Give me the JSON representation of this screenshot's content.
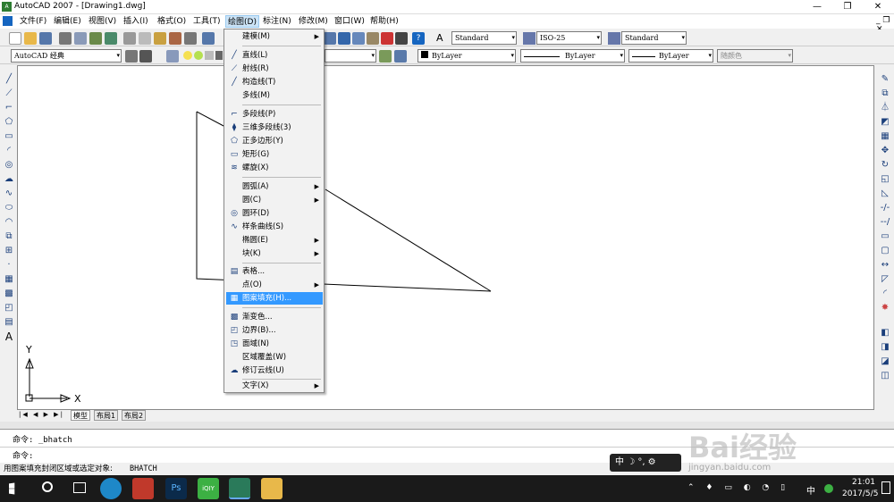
{
  "titlebar": {
    "title": "AutoCAD 2007 - [Drawing1.dwg]",
    "minimize": "—",
    "restore": "❐",
    "close": "✕"
  },
  "menubar": {
    "items": [
      "文件(F)",
      "编辑(E)",
      "视图(V)",
      "插入(I)",
      "格式(O)",
      "工具(T)",
      "绘图(D)",
      "标注(N)",
      "修改(M)",
      "窗口(W)",
      "帮助(H)"
    ],
    "active": "绘图(D)"
  },
  "toolbar": {
    "text_style": "Standard",
    "dim_style": "ISO-25",
    "table_style": "Standard",
    "workspace": "AutoCAD 经典",
    "color": "ByLayer",
    "linetype": "ByLayer",
    "lineweight": "ByLayer",
    "plotstyle": "随颜色"
  },
  "dropdown": {
    "items": [
      {
        "label": "建模(M)",
        "icon": "",
        "submenu": true
      },
      {
        "label": "直线(L)",
        "icon": "line-icon"
      },
      {
        "label": "射线(R)",
        "icon": "ray-icon"
      },
      {
        "label": "构造线(T)",
        "icon": "xline-icon"
      },
      {
        "label": "多线(M)",
        "icon": ""
      },
      {
        "label": "多段线(P)",
        "icon": "polyline-icon"
      },
      {
        "label": "三维多段线(3)",
        "icon": "3dpoly-icon"
      },
      {
        "label": "正多边形(Y)",
        "icon": "polygon-icon"
      },
      {
        "label": "矩形(G)",
        "icon": "rectangle-icon"
      },
      {
        "label": "螺旋(X)",
        "icon": "helix-icon"
      },
      {
        "label": "圆弧(A)",
        "icon": "",
        "submenu": true
      },
      {
        "label": "圆(C)",
        "icon": "",
        "submenu": true
      },
      {
        "label": "圆环(D)",
        "icon": "donut-icon"
      },
      {
        "label": "样条曲线(S)",
        "icon": "spline-icon"
      },
      {
        "label": "椭圆(E)",
        "icon": "",
        "submenu": true
      },
      {
        "label": "块(K)",
        "icon": "",
        "submenu": true
      },
      {
        "label": "表格...",
        "icon": "table-icon"
      },
      {
        "label": "点(O)",
        "icon": "",
        "submenu": true
      },
      {
        "label": "图案填充(H)...",
        "icon": "hatch-icon",
        "highlighted": true
      },
      {
        "label": "渐变色...",
        "icon": "gradient-icon"
      },
      {
        "label": "边界(B)...",
        "icon": "boundary-icon"
      },
      {
        "label": "面域(N)",
        "icon": "region-icon"
      },
      {
        "label": "区域覆盖(W)",
        "icon": ""
      },
      {
        "label": "修订云线(U)",
        "icon": "revcloud-icon"
      },
      {
        "label": "文字(X)",
        "icon": "",
        "submenu": true
      }
    ]
  },
  "ucs": {
    "x": "X",
    "y": "Y"
  },
  "tabs": {
    "model": "模型",
    "layout1": "布局1",
    "layout2": "布局2"
  },
  "command": {
    "line1": "命令: _bhatch",
    "line2": "命令:"
  },
  "status": {
    "left": "用图案填充封闭区域或选定对象:",
    "cmd": "BHATCH"
  },
  "ime": {
    "text": "中 ☽ °, ⚙"
  },
  "taskbar": {
    "time": "21:01",
    "date": "2017/5/5",
    "lang": "中"
  },
  "watermark": {
    "text": "Bai经验",
    "url": "jingyan.baidu.com"
  }
}
